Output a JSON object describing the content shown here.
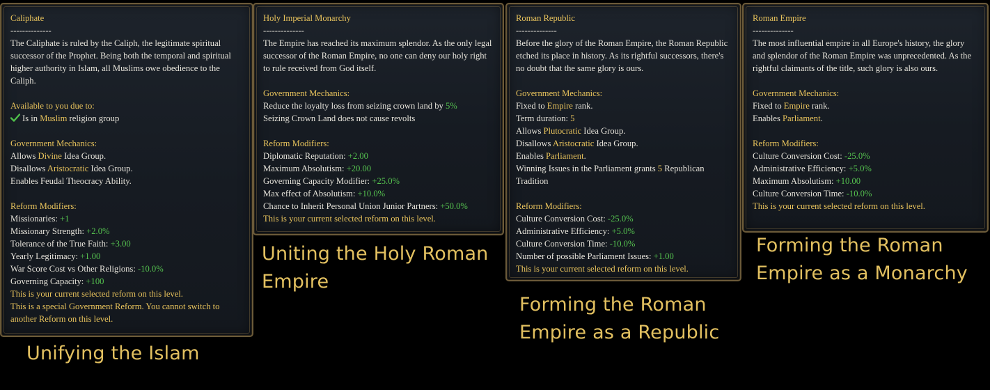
{
  "panels": {
    "caliphate": {
      "title": "Caliphate",
      "divider": "--------------",
      "description": "The Caliphate is ruled by the Caliph, the legitimate spiritual successor of the Prophet. Being both the temporal and spiritual higher authority in Islam, all Muslims owe obedience to the Caliph.",
      "available_heading": "Available to you due to:",
      "available_pre": "Is in ",
      "available_hl": "Muslim",
      "available_post": " religion group",
      "mech_heading": "Government Mechanics:",
      "mech1_pre": "Allows ",
      "mech1_hl": "Divine",
      "mech1_post": " Idea Group.",
      "mech2_pre": "Disallows ",
      "mech2_hl": "Aristocratic",
      "mech2_post": " Idea Group.",
      "mech3": "Enables Feudal Theocracy Ability.",
      "mod_heading": "Reform Modifiers:",
      "mods": [
        {
          "label": "Missionaries: ",
          "value": "+1"
        },
        {
          "label": "Missionary Strength: ",
          "value": "+2.0%"
        },
        {
          "label": "Tolerance of the True Faith: ",
          "value": "+3.00"
        },
        {
          "label": "Yearly Legitimacy: ",
          "value": "+1.00"
        },
        {
          "label": "War Score Cost vs Other Religions: ",
          "value": "-10.0%"
        },
        {
          "label": "Governing Capacity: ",
          "value": "+100"
        }
      ],
      "current_note": "This is your current selected reform on this level.",
      "special_note": "This is a special Government Reform. You cannot switch to another Reform on this level."
    },
    "holy_imperial": {
      "title": "Holy Imperial Monarchy",
      "divider": "--------------",
      "description": "The Empire has reached its maximum splendor. As the only legal successor of the Roman Empire, no one can deny our holy right to rule received from God itself.",
      "mech_heading": "Government Mechanics:",
      "mech1_pre": "Reduce the loyalty loss from seizing crown land by ",
      "mech1_hl": "5%",
      "mech2": "Seizing Crown Land does not cause revolts",
      "mod_heading": "Reform Modifiers:",
      "mods": [
        {
          "label": "Diplomatic Reputation: ",
          "value": "+2.00"
        },
        {
          "label": "Maximum Absolutism: ",
          "value": "+20.00"
        },
        {
          "label": "Governing Capacity Modifier: ",
          "value": "+25.0%"
        },
        {
          "label": "Max effect of Absolutism: ",
          "value": "+10.0%"
        },
        {
          "label": "Chance to Inherit Personal Union Junior Partners: ",
          "value": "+50.0%"
        }
      ],
      "current_note": "This is your current selected reform on this level."
    },
    "roman_republic": {
      "title": "Roman Republic",
      "divider": "--------------",
      "description": "Before the glory of the Roman Empire, the Roman Republic etched its place in history. As its rightful successors, there's no doubt that the same glory is ours.",
      "mech_heading": "Government Mechanics:",
      "mech1_pre": "Fixed to ",
      "mech1_hl": "Empire",
      "mech1_post": " rank.",
      "mech2_pre": "Term duration: ",
      "mech2_hl": "5",
      "mech3_pre": "Allows ",
      "mech3_hl": "Plutocratic",
      "mech3_post": " Idea Group.",
      "mech4_pre": "Disallows ",
      "mech4_hl": "Aristocratic",
      "mech4_post": " Idea Group.",
      "mech5_pre": "Enables ",
      "mech5_hl": "Parliament",
      "mech5_post": ".",
      "mech6_pre": "Winning Issues in the Parliament grants ",
      "mech6_hl": "5",
      "mech6_post": " Republican Tradition",
      "mod_heading": "Reform Modifiers:",
      "mods": [
        {
          "label": "Culture Conversion Cost: ",
          "value": "-25.0%"
        },
        {
          "label": "Administrative Efficiency: ",
          "value": "+5.0%"
        },
        {
          "label": "Culture Conversion Time: ",
          "value": "-10.0%"
        },
        {
          "label": "Number of possible Parliament Issues: ",
          "value": "+1.00"
        }
      ],
      "current_note": "This is your current selected reform on this level."
    },
    "roman_empire": {
      "title": "Roman Empire",
      "divider": "--------------",
      "description": "The most influential empire in all Europe's history, the glory and splendor of the Roman Empire was unprecedented. As the rightful claimants of the title, such glory is also ours.",
      "mech_heading": "Government Mechanics:",
      "mech1_pre": "Fixed to ",
      "mech1_hl": "Empire",
      "mech1_post": " rank.",
      "mech2_pre": "Enables ",
      "mech2_hl": "Parliament",
      "mech2_post": ".",
      "mod_heading": "Reform Modifiers:",
      "mods": [
        {
          "label": "Culture Conversion Cost: ",
          "value": "-25.0%"
        },
        {
          "label": "Administrative Efficiency: ",
          "value": "+5.0%"
        },
        {
          "label": "Maximum Absolutism: ",
          "value": "+10.00"
        },
        {
          "label": "Culture Conversion Time: ",
          "value": "-10.0%"
        }
      ],
      "current_note": "This is your current selected reform on this level."
    }
  },
  "captions": {
    "caliphate": "Unifying the Islam",
    "holy_imperial": "Uniting the Holy Roman Empire",
    "roman_republic": "Forming the Roman Empire as a Republic",
    "roman_empire": "Forming the Roman Empire as a Monarchy"
  },
  "colors": {
    "title": "#e8c35c",
    "positive": "#55c24f",
    "text": "#e6e3da",
    "caption": "#e2c060",
    "border": "#6b5a39"
  },
  "icons": {
    "available_check": "checkmark-icon"
  }
}
